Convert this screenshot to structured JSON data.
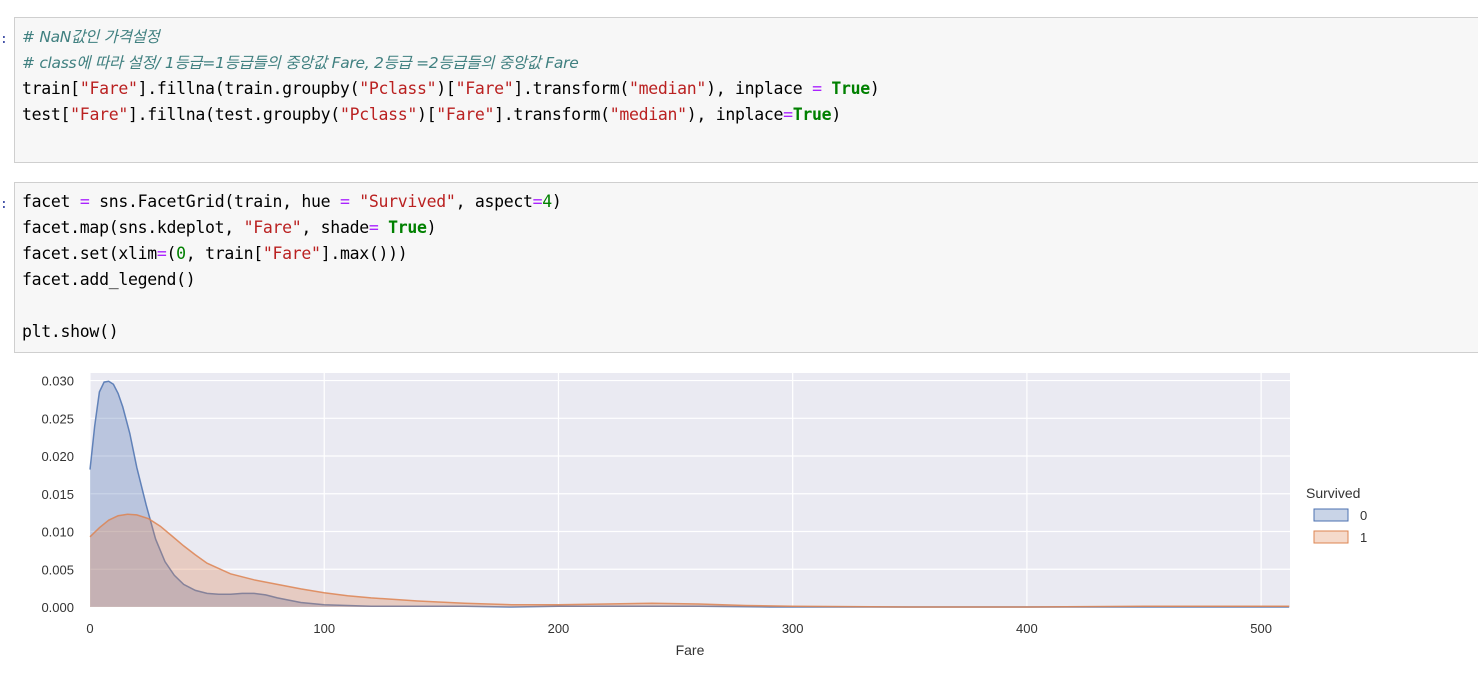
{
  "cells": [
    {
      "lines": [
        [
          {
            "t": "# NaN값인 가격설정",
            "c": "comment"
          }
        ],
        [
          {
            "t": "# class에 따라 설정/ 1등급=1등급들의 중앙값 Fare, 2등급 =2등급들의 중앙값 Fare",
            "c": "comment"
          }
        ],
        [
          {
            "t": "train[",
            "c": ""
          },
          {
            "t": "\"Fare\"",
            "c": "str"
          },
          {
            "t": "].fillna(train.groupby(",
            "c": ""
          },
          {
            "t": "\"Pclass\"",
            "c": "str"
          },
          {
            "t": ")[",
            "c": ""
          },
          {
            "t": "\"Fare\"",
            "c": "str"
          },
          {
            "t": "].transform(",
            "c": ""
          },
          {
            "t": "\"median\"",
            "c": "str"
          },
          {
            "t": "), inplace ",
            "c": ""
          },
          {
            "t": "=",
            "c": "op"
          },
          {
            "t": " ",
            "c": ""
          },
          {
            "t": "True",
            "c": "kw"
          },
          {
            "t": ")",
            "c": ""
          }
        ],
        [
          {
            "t": "test[",
            "c": ""
          },
          {
            "t": "\"Fare\"",
            "c": "str"
          },
          {
            "t": "].fillna(test.groupby(",
            "c": ""
          },
          {
            "t": "\"Pclass\"",
            "c": "str"
          },
          {
            "t": ")[",
            "c": ""
          },
          {
            "t": "\"Fare\"",
            "c": "str"
          },
          {
            "t": "].transform(",
            "c": ""
          },
          {
            "t": "\"median\"",
            "c": "str"
          },
          {
            "t": "), inplace",
            "c": ""
          },
          {
            "t": "=",
            "c": "op"
          },
          {
            "t": "True",
            "c": "kw"
          },
          {
            "t": ")",
            "c": ""
          }
        ]
      ]
    },
    {
      "lines": [
        [
          {
            "t": "facet ",
            "c": ""
          },
          {
            "t": "=",
            "c": "op"
          },
          {
            "t": " sns.FacetGrid(train, hue ",
            "c": ""
          },
          {
            "t": "=",
            "c": "op"
          },
          {
            "t": " ",
            "c": ""
          },
          {
            "t": "\"Survived\"",
            "c": "str"
          },
          {
            "t": ", aspect",
            "c": ""
          },
          {
            "t": "=",
            "c": "op"
          },
          {
            "t": "4",
            "c": "num"
          },
          {
            "t": ")",
            "c": ""
          }
        ],
        [
          {
            "t": "facet.map(sns.kdeplot, ",
            "c": ""
          },
          {
            "t": "\"Fare\"",
            "c": "str"
          },
          {
            "t": ", shade",
            "c": ""
          },
          {
            "t": "=",
            "c": "op"
          },
          {
            "t": " ",
            "c": ""
          },
          {
            "t": "True",
            "c": "kw"
          },
          {
            "t": ")",
            "c": ""
          }
        ],
        [
          {
            "t": "facet.set(xlim",
            "c": ""
          },
          {
            "t": "=",
            "c": "op"
          },
          {
            "t": "(",
            "c": ""
          },
          {
            "t": "0",
            "c": "num"
          },
          {
            "t": ", train[",
            "c": ""
          },
          {
            "t": "\"Fare\"",
            "c": "str"
          },
          {
            "t": "].max()))",
            "c": ""
          }
        ],
        [
          {
            "t": "facet.add_legend()",
            "c": ""
          }
        ],
        [
          {
            "t": "",
            "c": ""
          }
        ],
        [
          {
            "t": "plt.show()",
            "c": ""
          }
        ]
      ]
    }
  ],
  "chart_data": {
    "type": "area",
    "title": "",
    "xlabel": "Fare",
    "ylabel": "",
    "xlim": [
      0,
      512.3292
    ],
    "ylim": [
      0,
      0.031
    ],
    "xticks": [
      "0",
      "100",
      "200",
      "300",
      "400",
      "500"
    ],
    "yticks": [
      "0.000",
      "0.005",
      "0.010",
      "0.015",
      "0.020",
      "0.025",
      "0.030"
    ],
    "grid": true,
    "legend": {
      "title": "Survived",
      "placement": "right"
    },
    "series": [
      {
        "name": "0",
        "color": "#4c72b0",
        "x": [
          0,
          2,
          4,
          6,
          8,
          10,
          12,
          14,
          17,
          20,
          24,
          28,
          32,
          36,
          40,
          45,
          50,
          55,
          60,
          65,
          70,
          75,
          80,
          90,
          100,
          110,
          120,
          140,
          160,
          180,
          200,
          230,
          260,
          290,
          350,
          400,
          450,
          512
        ],
        "y": [
          0.0182,
          0.024,
          0.0285,
          0.0298,
          0.0299,
          0.0295,
          0.0283,
          0.0265,
          0.023,
          0.0185,
          0.0135,
          0.009,
          0.006,
          0.0042,
          0.003,
          0.0022,
          0.0018,
          0.0017,
          0.0017,
          0.0018,
          0.0018,
          0.0016,
          0.0012,
          0.0006,
          0.0003,
          0.0002,
          0.0001,
          0.0001,
          0.0001,
          0.0,
          0.0001,
          0.0001,
          0.0001,
          0.0,
          0.0,
          0.0,
          0.0,
          0.0
        ]
      },
      {
        "name": "1",
        "color": "#dd8452",
        "x": [
          0,
          4,
          8,
          12,
          16,
          20,
          25,
          30,
          35,
          40,
          45,
          50,
          60,
          70,
          80,
          90,
          100,
          110,
          120,
          140,
          160,
          180,
          200,
          220,
          240,
          260,
          280,
          300,
          350,
          400,
          450,
          512
        ],
        "y": [
          0.0093,
          0.0105,
          0.0115,
          0.0121,
          0.0123,
          0.0122,
          0.0117,
          0.0107,
          0.0094,
          0.0081,
          0.0069,
          0.0058,
          0.0044,
          0.0036,
          0.003,
          0.0024,
          0.0019,
          0.0015,
          0.0012,
          0.0008,
          0.0005,
          0.0003,
          0.0003,
          0.0004,
          0.0005,
          0.0004,
          0.0002,
          0.0001,
          0.0,
          0.0,
          0.0001,
          0.0001
        ]
      }
    ]
  }
}
